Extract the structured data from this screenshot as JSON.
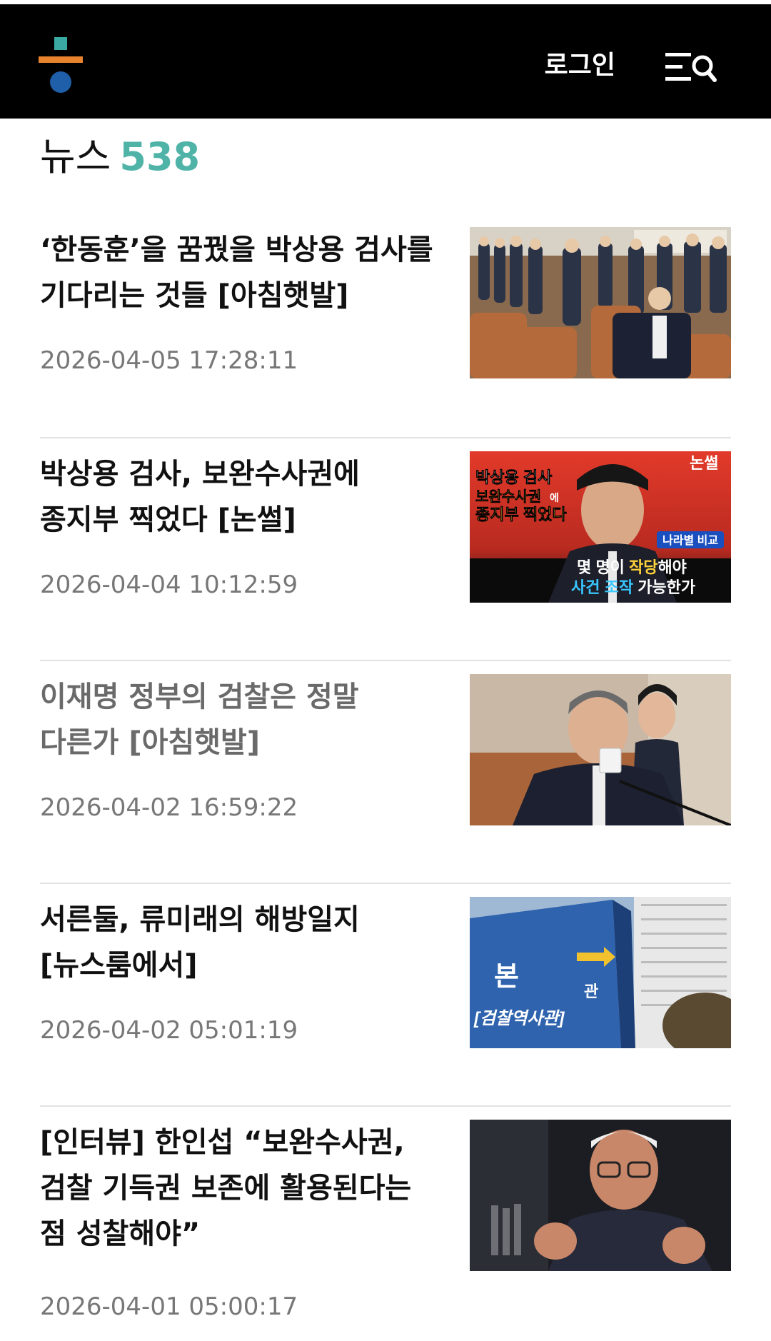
{
  "header": {
    "login_label": "로그인",
    "colors": {
      "background": "#000000",
      "logo_teal": "#3aa9a2",
      "logo_orange": "#e8832e",
      "logo_blue": "#1f5ea8"
    },
    "icons": {
      "logo": "brand-logo-icon",
      "menu_search": "menu-search-icon"
    }
  },
  "section": {
    "title": "뉴스",
    "count": "538",
    "count_color": "#4fb3a8"
  },
  "news": [
    {
      "headline": "‘한동훈’을 꿈꿨을 박상용 검사를 기다리는 것들 [아침햇발]",
      "date": "2026-04-05 17:28:11",
      "image": "prosecutors-hearing-photo"
    },
    {
      "headline_parts": [
        "박상용 검사, ",
        "보완수사권",
        "에 종지부 찍었다 [논썰]"
      ],
      "date": "2026-04-04 10:12:59",
      "image": "video-thumbnail",
      "thumbnail_text": {
        "brand": "논썰",
        "left_line1": "박상용 검사",
        "left_line2": "보완수사권",
        "left_line2_suffix": "에",
        "left_line3": "종지부 찍었다",
        "tag": "나라별 비교",
        "bottom_line1_a": "몇 명이 ",
        "bottom_line1_b": "작당",
        "bottom_line1_c": "해야",
        "bottom_line2_a": "사건 조작",
        "bottom_line2_b": " 가능한가"
      }
    },
    {
      "headline": "이재명 정부의 검찰은 정말 다른가 [아침햇발]",
      "date": "2026-04-02 16:59:22",
      "image": "official-drinking-water-photo",
      "visited": true
    },
    {
      "headline": "서른둘, 류미래의 해방일지 [뉴스룸에서]",
      "date": "2026-04-02 05:01:19",
      "image": "prosecution-building-sign-photo",
      "sign_text": {
        "top": "본",
        "right": "관",
        "bottom": "[검찰역사관]"
      }
    },
    {
      "headline": "[인터뷰] 한인섭 “보완수사권, 검찰 기득권 보존에 활용된다는 점 성찰해야”",
      "date": "2026-04-01 05:00:17",
      "image": "interview-portrait-photo"
    }
  ]
}
